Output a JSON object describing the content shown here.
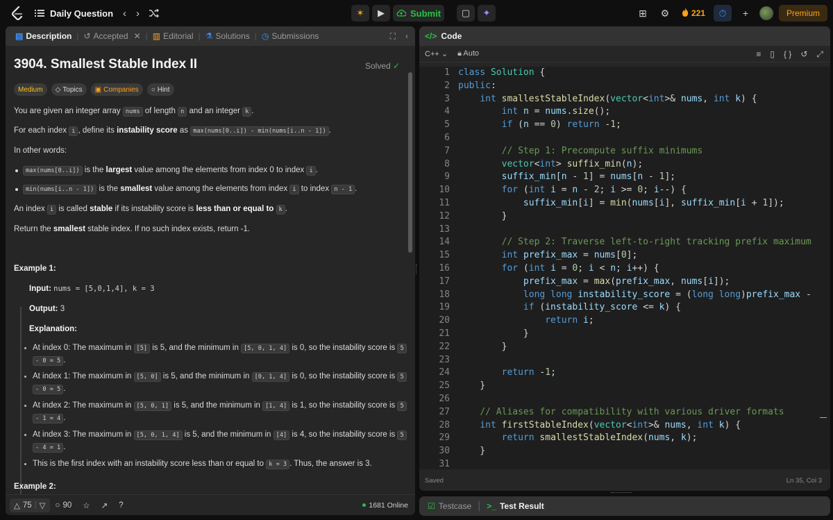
{
  "nav": {
    "title": "Daily Question",
    "submit": "Submit",
    "streak": "221",
    "premium": "Premium"
  },
  "tabs": {
    "description": "Description",
    "accepted": "Accepted",
    "editorial": "Editorial",
    "solutions": "Solutions",
    "submissions": "Submissions"
  },
  "problem": {
    "title": "3904. Smallest Stable Index II",
    "status": "Solved",
    "difficulty": "Medium",
    "chips": [
      "Topics",
      "Companies",
      "Hint"
    ],
    "p1": {
      "a": "You are given an integer array ",
      "c1": "nums",
      "b": " of length ",
      "c2": "n",
      "c": " and an integer ",
      "c3": "k",
      "d": "."
    },
    "p2": {
      "a": "For each index ",
      "c1": "i",
      "b": ", define its ",
      "s": "instability score",
      "c": " as ",
      "c2": "max(nums[0..i]) - min(nums[i..n - 1])",
      "d": "."
    },
    "p3": "In other words:",
    "li1": {
      "c1": "max(nums[0..i])",
      "a": " is the ",
      "s": "largest",
      "b": " value among the elements from index 0 to index ",
      "c2": "i",
      "d": "."
    },
    "li2": {
      "c1": "min(nums[i..n - 1])",
      "a": " is the ",
      "s": "smallest",
      "b": " value among the elements from index ",
      "c2": "i",
      "c": " to index ",
      "c3": "n - 1",
      "d": "."
    },
    "p4": {
      "a": "An index ",
      "c1": "i",
      "b": " is called ",
      "s1": "stable",
      "c": " if its instability score is ",
      "s2": "less than or equal to",
      "d": " ",
      "c2": "k",
      "e": "."
    },
    "p5": {
      "a": "Return the ",
      "s": "smallest",
      "b": " stable index. If no such index exists, return -1."
    },
    "example1": {
      "heading": "Example 1:",
      "input_label": "Input:",
      "input_value": "nums = [5,0,1,4], k = 3",
      "output_label": "Output:",
      "output_value": "3",
      "explanation_label": "Explanation:",
      "items": [
        {
          "a": "At index 0: The maximum in ",
          "c1": "[5]",
          "b": " is 5, and the minimum in ",
          "c2": "[5, 0, 1, 4]",
          "c": " is 0, so the instability score is ",
          "c3": "5",
          "c4": "- 0 = 5",
          "d": "."
        },
        {
          "a": "At index 1: The maximum in ",
          "c1": "[5, 0]",
          "b": " is 5, and the minimum in ",
          "c2": "[0, 1, 4]",
          "c": " is 0, so the instability score is ",
          "c3": "5",
          "c4": "- 0 = 5",
          "d": "."
        },
        {
          "a": "At index 2: The maximum in ",
          "c1": "[5, 0, 1]",
          "b": " is 5, and the minimum in ",
          "c2": "[1, 4]",
          "c": " is 1, so the instability score is ",
          "c3": "5",
          "c4": "- 1 = 4",
          "d": "."
        },
        {
          "a": "At index 3: The maximum in ",
          "c1": "[5, 0, 1, 4]",
          "b": " is 5, and the minimum in ",
          "c2": "[4]",
          "c": " is 4, so the instability score is ",
          "c3": "5",
          "c4": "- 4 = 1",
          "d": "."
        }
      ],
      "last": {
        "a": "This is the first index with an instability score less than or equal to ",
        "c1": "k = 3",
        "b": ". Thus, the answer is 3."
      }
    },
    "example2_heading": "Example 2:"
  },
  "footer": {
    "likes": "75",
    "comments": "90",
    "online": "1681 Online"
  },
  "editor": {
    "header": "Code",
    "language": "C++",
    "mode": "Auto",
    "saved": "Saved",
    "cursor": "Ln 35, Col 3",
    "line_numbers": [
      "1",
      "2",
      "3",
      "4",
      "5",
      "6",
      "7",
      "8",
      "9",
      "10",
      "11",
      "12",
      "13",
      "14",
      "15",
      "16",
      "17",
      "18",
      "19",
      "20",
      "21",
      "22",
      "23",
      "24",
      "25",
      "26",
      "27",
      "28",
      "29",
      "30",
      "31"
    ]
  },
  "bottom": {
    "testcase": "Testcase",
    "result": "Test Result"
  },
  "colors": {
    "accent_orange": "#ffa116",
    "submit_green": "#28c244",
    "medium_yellow": "#ffc01e"
  }
}
